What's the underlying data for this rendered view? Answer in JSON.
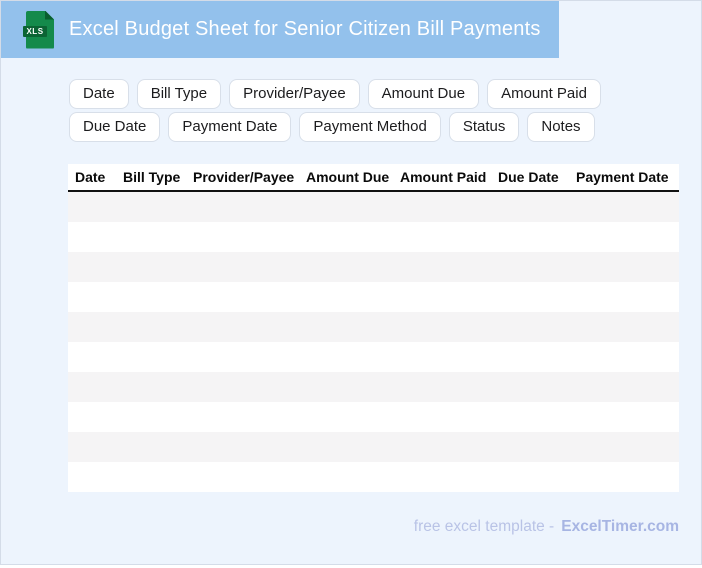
{
  "window": {
    "title": "Excel Budget Sheet for Senior Citizen Bill Payments",
    "icon_label": "XLS"
  },
  "toolbar": {
    "chips": [
      "Date",
      "Bill Type",
      "Provider/Payee",
      "Amount Due",
      "Amount Paid",
      "Due Date",
      "Payment Date",
      "Payment Method",
      "Status",
      "Notes"
    ]
  },
  "table": {
    "columns": [
      "Date",
      "Bill Type",
      "Provider/Payee",
      "Amount Due",
      "Amount Paid",
      "Due Date",
      "Payment Date"
    ],
    "empty_row_count": 10,
    "rows": []
  },
  "footer": {
    "caption": "free excel template -",
    "brand": "ExcelTimer.com"
  },
  "colors": {
    "header_bar": "#93c1ec",
    "page_bg": "#edf4fd",
    "chip_border": "#d8dfe9",
    "row_stripe": "#f5f4f5",
    "icon_body": "#148a4b",
    "icon_band": "#0b6434",
    "icon_fold": "#0a5e2f",
    "footer_caption": "#b9c3e6",
    "footer_brand": "#a7b5e3"
  }
}
